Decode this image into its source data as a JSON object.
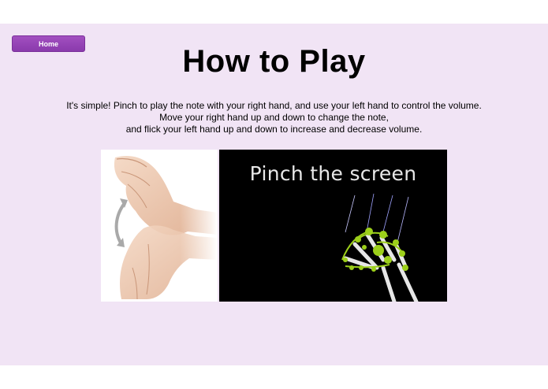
{
  "nav": {
    "home_label": "Home"
  },
  "page": {
    "title": "How to Play",
    "instructions": [
      "It's simple! Pinch to play the note with your right hand, and use your left hand to control the volume.",
      "Move your right hand up and down to change the note,",
      "and flick your left hand up and down to increase and decrease volume."
    ]
  },
  "media": {
    "caption": "Pinch the screen"
  },
  "colors": {
    "page_background": "#f1e4f5",
    "button_purple": "#9645b8",
    "hand_skin": "#e9c2a8",
    "skeleton_green": "#9ccf1a"
  }
}
